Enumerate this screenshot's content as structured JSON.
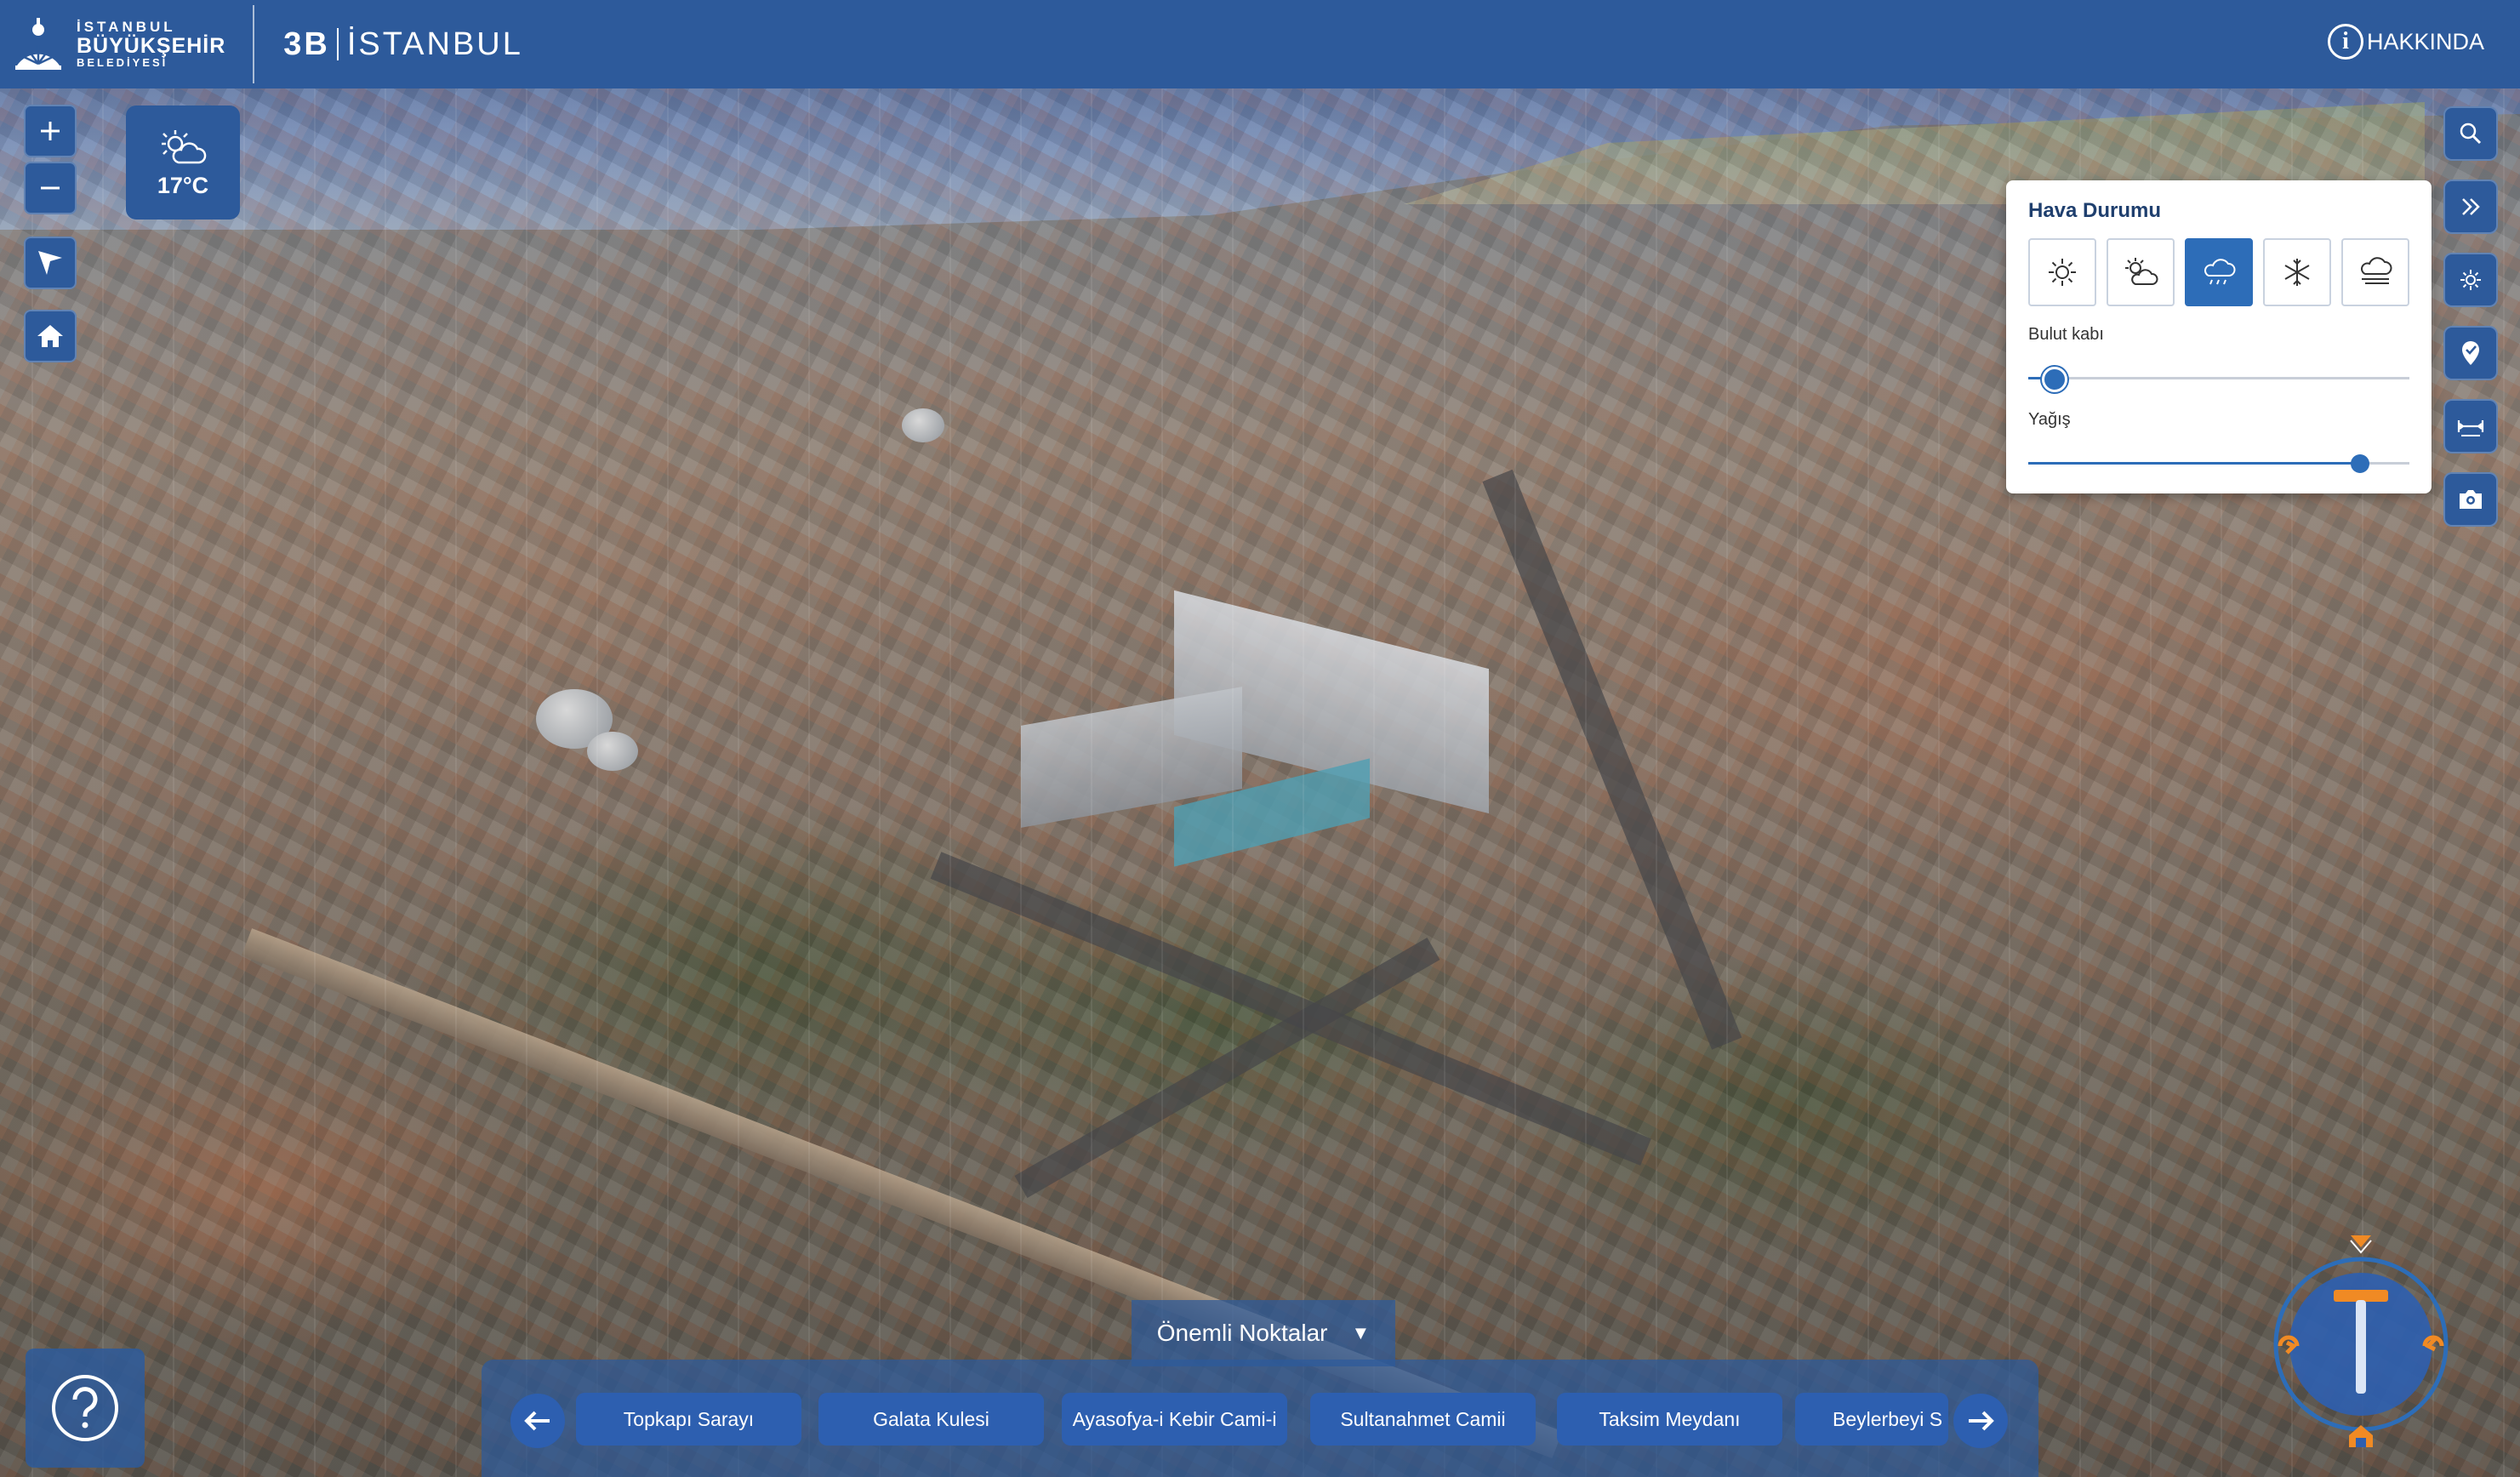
{
  "header": {
    "org_line1": "İSTANBUL",
    "org_line2": "BÜYÜKŞEHİR",
    "org_line3": "BELEDİYESİ",
    "brand_bold": "3B",
    "brand_light": "İSTANBUL",
    "about_label": "HAKKINDA",
    "about_icon": "info-circle-icon"
  },
  "map_controls": {
    "zoom_in_icon": "plus-icon",
    "zoom_out_icon": "minus-icon",
    "navigate_icon": "navigation-arrow-icon",
    "home_icon": "home-icon",
    "weather_icon": "partly-cloudy-icon",
    "temperature": "17°C"
  },
  "right_toolbar": {
    "items": [
      {
        "icon": "search-icon"
      },
      {
        "icon": "double-chevron-right-icon"
      },
      {
        "icon": "sun-icon"
      },
      {
        "icon": "location-pin-icon"
      },
      {
        "icon": "measure-icon"
      },
      {
        "icon": "camera-icon"
      }
    ]
  },
  "weather_panel": {
    "title": "Hava Durumu",
    "modes": [
      {
        "icon": "sun-icon",
        "active": false
      },
      {
        "icon": "partly-cloudy-icon",
        "active": false
      },
      {
        "icon": "rain-icon",
        "active": true
      },
      {
        "icon": "snowflake-icon",
        "active": false
      },
      {
        "icon": "fog-icon",
        "active": false
      }
    ],
    "cloud_label": "Bulut kabı",
    "cloud_value": 0.07,
    "rain_label": "Yağış",
    "rain_value": 0.87
  },
  "poi": {
    "toggle_label": "Önemli Noktalar",
    "toggle_icon": "triangle-down-icon",
    "prev_icon": "arrow-left-icon",
    "next_icon": "arrow-right-icon",
    "items": [
      "Topkapı Sarayı",
      "Galata Kulesi",
      "Ayasofya-i Kebir Cami-i",
      "Sultanahmet Camii",
      "Taksim Meydanı",
      "Beylerbeyi S"
    ]
  },
  "help": {
    "icon": "question-circle-icon"
  },
  "compass": {
    "icon": "compass-icon"
  },
  "colors": {
    "brand_blue": "#2d5a9b",
    "accent_blue": "#2d6db8",
    "compass_orange": "#f08a24"
  }
}
